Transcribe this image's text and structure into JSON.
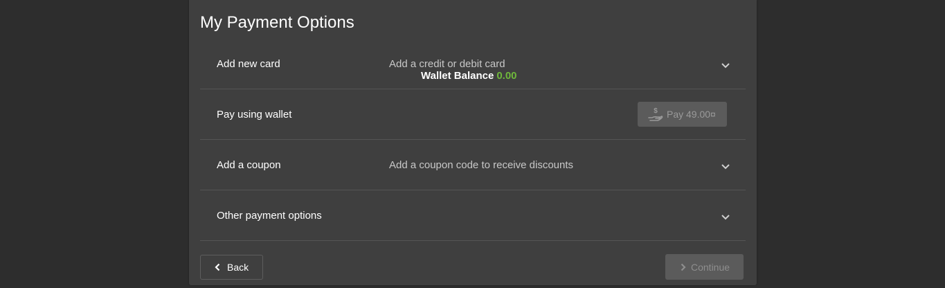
{
  "page": {
    "title": "My Payment Options"
  },
  "rows": [
    {
      "label": "Add new card",
      "description": "Add a credit or debit card",
      "chevron_icon": "chevron-down-icon"
    },
    {
      "label": "Pay using wallet",
      "wallet_balance_label": "Wallet Balance",
      "wallet_balance_value": "0.00",
      "pay_button_label": "Pay 49.00¤",
      "pay_icon": "hand-money-icon"
    },
    {
      "label": "Add a coupon",
      "description": "Add a coupon code to receive discounts",
      "chevron_icon": "chevron-down-icon"
    },
    {
      "label": "Other payment options",
      "chevron_icon": "chevron-down-icon"
    }
  ],
  "footer": {
    "back_label": "Back",
    "continue_label": "Continue"
  },
  "colors": {
    "background": "#2d2d2d",
    "panel": "#3f3f3f",
    "divider": "#555555",
    "balance_green": "#6fb83b",
    "disabled_button": "#5b5b5b"
  }
}
